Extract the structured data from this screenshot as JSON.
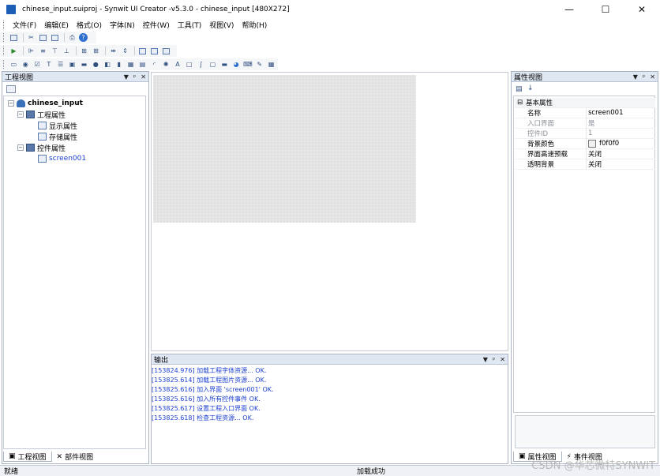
{
  "window": {
    "title": "chinese_input.suiproj - Synwit UI Creator -v5.3.0 - chinese_input [480X272]",
    "minimize": "—",
    "maximize": "☐",
    "close": "✕"
  },
  "menu": [
    "文件(F)",
    "编辑(E)",
    "格式(O)",
    "字体(N)",
    "控件(W)",
    "工具(T)",
    "视图(V)",
    "帮助(H)"
  ],
  "project_panel": {
    "title": "工程视图",
    "root": "chinese_input",
    "project_props": "工程属性",
    "display_props": "显示属性",
    "storage_props": "存储属性",
    "widget_props": "控件属性",
    "screen": "screen001",
    "tabs": [
      "工程视图",
      "部件视图"
    ]
  },
  "output_panel": {
    "title": "输出",
    "lines": [
      "[153824.976] 加载工程字体资源... OK.",
      "[153825.614] 加载工程图片资源... OK.",
      "[153825.616] 加入界面 'screen001' OK.",
      "[153825.616] 加入所有控件事件 OK.",
      "[153825.617] 设置工程入口界面 OK.",
      "[153825.618] 检查工程资源... OK."
    ]
  },
  "property_panel": {
    "title": "属性视图",
    "category": "基本属性",
    "rows": [
      {
        "name": "名称",
        "value": "screen001",
        "dim": false
      },
      {
        "name": "入口界面",
        "value": "是",
        "dim": true
      },
      {
        "name": "控件ID",
        "value": "1",
        "dim": true
      },
      {
        "name": "背景颜色",
        "value": "f0f0f0",
        "dim": false
      },
      {
        "name": "界面高速预载",
        "value": "关闭",
        "dim": false
      },
      {
        "name": "透明背景",
        "value": "关闭",
        "dim": false
      }
    ],
    "tabs": [
      "属性视图",
      "事件视图"
    ]
  },
  "status": {
    "left": "就绪",
    "center": "加载成功"
  },
  "watermark": "CSDN @华芯微特SYNWIT",
  "colors": {
    "panel_header": "#dfe7f3",
    "log_text": "#1a3fd0",
    "canvas_bg": "#f0f0f0"
  }
}
